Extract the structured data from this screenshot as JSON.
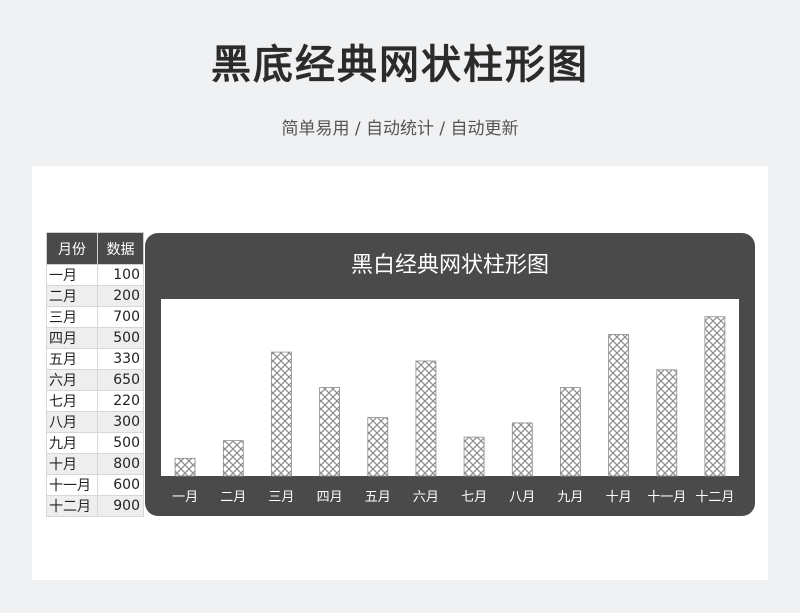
{
  "header": {
    "title": "黑底经典网状柱形图",
    "subtitle": "简单易用 / 自动统计 / 自动更新"
  },
  "table": {
    "columns": [
      "月份",
      "数据"
    ],
    "rows": [
      [
        "一月",
        "100"
      ],
      [
        "二月",
        "200"
      ],
      [
        "三月",
        "700"
      ],
      [
        "四月",
        "500"
      ],
      [
        "五月",
        "330"
      ],
      [
        "六月",
        "650"
      ],
      [
        "七月",
        "220"
      ],
      [
        "八月",
        "300"
      ],
      [
        "九月",
        "500"
      ],
      [
        "十月",
        "800"
      ],
      [
        "十一月",
        "600"
      ],
      [
        "十二月",
        "900"
      ]
    ]
  },
  "colors": {
    "panel": "#4a4a4a",
    "plot_bg": "#ffffff",
    "bar_pattern": "#8c8c8c"
  },
  "chart_data": {
    "type": "bar",
    "title": "黑白经典网状柱形图",
    "categories": [
      "一月",
      "二月",
      "三月",
      "四月",
      "五月",
      "六月",
      "七月",
      "八月",
      "九月",
      "十月",
      "十一月",
      "十二月"
    ],
    "values": [
      100,
      200,
      700,
      500,
      330,
      650,
      220,
      300,
      500,
      800,
      600,
      900
    ],
    "ylim": [
      0,
      1000
    ],
    "grid": false,
    "legend": "none",
    "bar_fill": "crosshatch"
  }
}
